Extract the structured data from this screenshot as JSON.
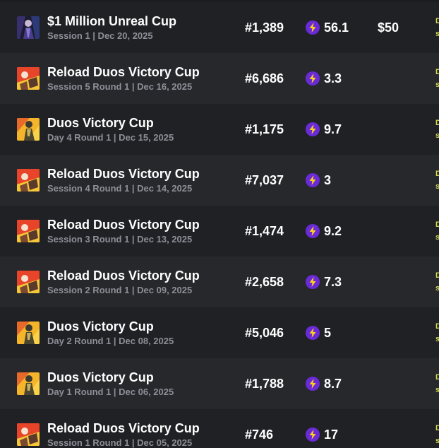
{
  "colors": {
    "background": "#1a1c20",
    "row_odd": "#1f2125",
    "row_even": "#26282c",
    "bolt_circle": "#6a2bd6",
    "bolt": "#ffd21a",
    "edge_text": "#d4d84a"
  },
  "icons": {
    "points": "lightning-bolt-icon"
  },
  "rows": [
    {
      "title": "$1 Million Unreal Cup",
      "subtitle": "Session 1 | Dec 20, 2025",
      "rank": "#1,389",
      "points": "56.1",
      "prize": "$50",
      "thumb": "unreal-cup-thumbnail",
      "edge_1": "D",
      "edge_2": "s"
    },
    {
      "title": "Reload Duos Victory Cup",
      "subtitle": "Session 5 Round 1 | Dec 16, 2025",
      "rank": "#6,686",
      "points": "3.3",
      "prize": "",
      "thumb": "reload-cup-thumbnail",
      "edge_1": "D",
      "edge_2": "s"
    },
    {
      "title": "Duos Victory Cup",
      "subtitle": "Day 4 Round 1 | Dec 15, 2025",
      "rank": "#1,175",
      "points": "9.7",
      "prize": "",
      "thumb": "duos-cup-thumbnail",
      "edge_1": "D",
      "edge_2": "s"
    },
    {
      "title": "Reload Duos Victory Cup",
      "subtitle": "Session 4 Round 1 | Dec 14, 2025",
      "rank": "#7,037",
      "points": "3",
      "prize": "",
      "thumb": "reload-cup-thumbnail",
      "edge_1": "D",
      "edge_2": "s"
    },
    {
      "title": "Reload Duos Victory Cup",
      "subtitle": "Session 3 Round 1 | Dec 13, 2025",
      "rank": "#1,474",
      "points": "9.2",
      "prize": "",
      "thumb": "reload-cup-thumbnail",
      "edge_1": "D",
      "edge_2": "s"
    },
    {
      "title": "Reload Duos Victory Cup",
      "subtitle": "Session 2 Round 1 | Dec 09, 2025",
      "rank": "#2,658",
      "points": "7.3",
      "prize": "",
      "thumb": "reload-cup-thumbnail",
      "edge_1": "D",
      "edge_2": "s"
    },
    {
      "title": "Duos Victory Cup",
      "subtitle": "Day 2 Round 1 | Dec 08, 2025",
      "rank": "#5,046",
      "points": "5",
      "prize": "",
      "thumb": "duos-cup-thumbnail",
      "edge_1": "D",
      "edge_2": "s"
    },
    {
      "title": "Duos Victory Cup",
      "subtitle": "Day 1 Round 1 | Dec 06, 2025",
      "rank": "#1,788",
      "points": "8.7",
      "prize": "",
      "thumb": "duos-cup-thumbnail",
      "edge_1": "D",
      "edge_2": "s"
    },
    {
      "title": "Reload Duos Victory Cup",
      "subtitle": "Session 1 Round 1 | Dec 05, 2025",
      "rank": "#746",
      "points": "17",
      "prize": "",
      "thumb": "reload-cup-thumbnail",
      "edge_1": "D",
      "edge_2": "s"
    }
  ]
}
